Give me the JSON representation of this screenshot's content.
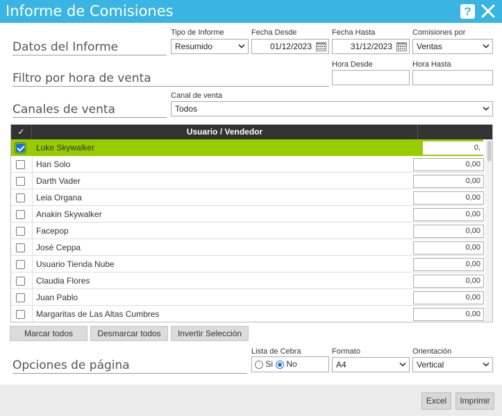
{
  "window": {
    "title": "Informe de Comisiones",
    "help_label": "?"
  },
  "sections": {
    "report_data": "Datos del Informe",
    "hour_filter": "Filtro por hora de venta",
    "sales_channels": "Canales de venta",
    "page_options": "Opciones de página"
  },
  "report": {
    "type_label": "Tipo de Informe",
    "type_value": "Resumido",
    "from_label": "Fecha Desde",
    "from_value": "01/12/2023",
    "to_label": "Fecha Hasta",
    "to_value": "31/12/2023",
    "by_label": "Comisiones por",
    "by_value": "Ventas"
  },
  "hours": {
    "from_label": "Hora Desde",
    "from_value": "",
    "to_label": "Hora Hasta",
    "to_value": ""
  },
  "channel": {
    "label": "Canal de venta",
    "value": "Todos"
  },
  "grid": {
    "check_header": "✓",
    "name_header": "Usuario / Vendedor",
    "amount_header": "",
    "rows": [
      {
        "name": "Luke Skywalker",
        "amount": "0,",
        "checked": true,
        "selected": true
      },
      {
        "name": "Han Solo",
        "amount": "0,00",
        "checked": false,
        "selected": false
      },
      {
        "name": "Darth Vader",
        "amount": "0,00",
        "checked": false,
        "selected": false
      },
      {
        "name": "Leia Organa",
        "amount": "0,00",
        "checked": false,
        "selected": false
      },
      {
        "name": "Anakin Skywalker",
        "amount": "0,00",
        "checked": false,
        "selected": false
      },
      {
        "name": "Facepop",
        "amount": "0,00",
        "checked": false,
        "selected": false
      },
      {
        "name": "José Ceppa",
        "amount": "0,00",
        "checked": false,
        "selected": false
      },
      {
        "name": "Usuario Tienda Nube",
        "amount": "0,00",
        "checked": false,
        "selected": false
      },
      {
        "name": "Claudia Flores",
        "amount": "0,00",
        "checked": false,
        "selected": false
      },
      {
        "name": "Juan Pablo",
        "amount": "0,00",
        "checked": false,
        "selected": false
      },
      {
        "name": "Margaritas de Las Altas Cumbres",
        "amount": "0,00",
        "checked": false,
        "selected": false
      }
    ]
  },
  "grid_buttons": {
    "mark_all": "Marcar todos",
    "unmark_all": "Desmarcar todos",
    "invert": "Invertir Selección"
  },
  "page_options": {
    "zebra_label": "Lista de Cebra",
    "zebra_yes": "Si",
    "zebra_no": "No",
    "zebra_value": "No",
    "format_label": "Formato",
    "format_value": "A4",
    "orientation_label": "Orientación",
    "orientation_value": "Vertical"
  },
  "footer": {
    "excel_label": "Excel",
    "print_label": "Imprimir"
  },
  "colors": {
    "titlebar": "#3ab4e2",
    "selected_row": "#97cc00",
    "grid_header": "#333333",
    "checkbox_accent": "#1e6fe0"
  }
}
